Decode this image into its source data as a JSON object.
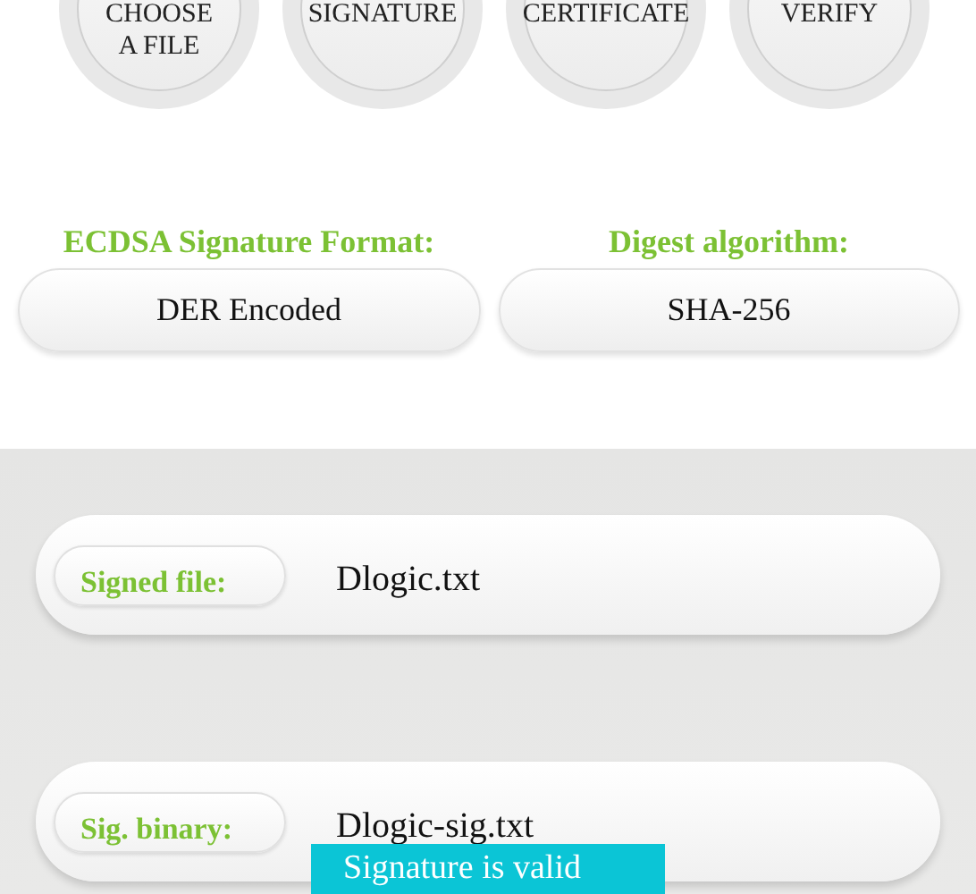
{
  "actions": [
    {
      "lines": [
        "CHOOSE",
        "A FILE"
      ]
    },
    {
      "lines": [
        "SIGNATURE"
      ]
    },
    {
      "lines": [
        "CERTIFICATE"
      ]
    },
    {
      "lines": [
        "VERIFY"
      ]
    }
  ],
  "settings": [
    {
      "label": "ECDSA Signature Format:",
      "value": "DER Encoded"
    },
    {
      "label": "Digest algorithm:",
      "value": "SHA-256"
    }
  ],
  "files": [
    {
      "label": "Signed file:",
      "value": "Dlogic.txt"
    },
    {
      "label": "Sig. binary:",
      "value": "Dlogic-sig.txt"
    }
  ],
  "toast": "Signature is valid"
}
